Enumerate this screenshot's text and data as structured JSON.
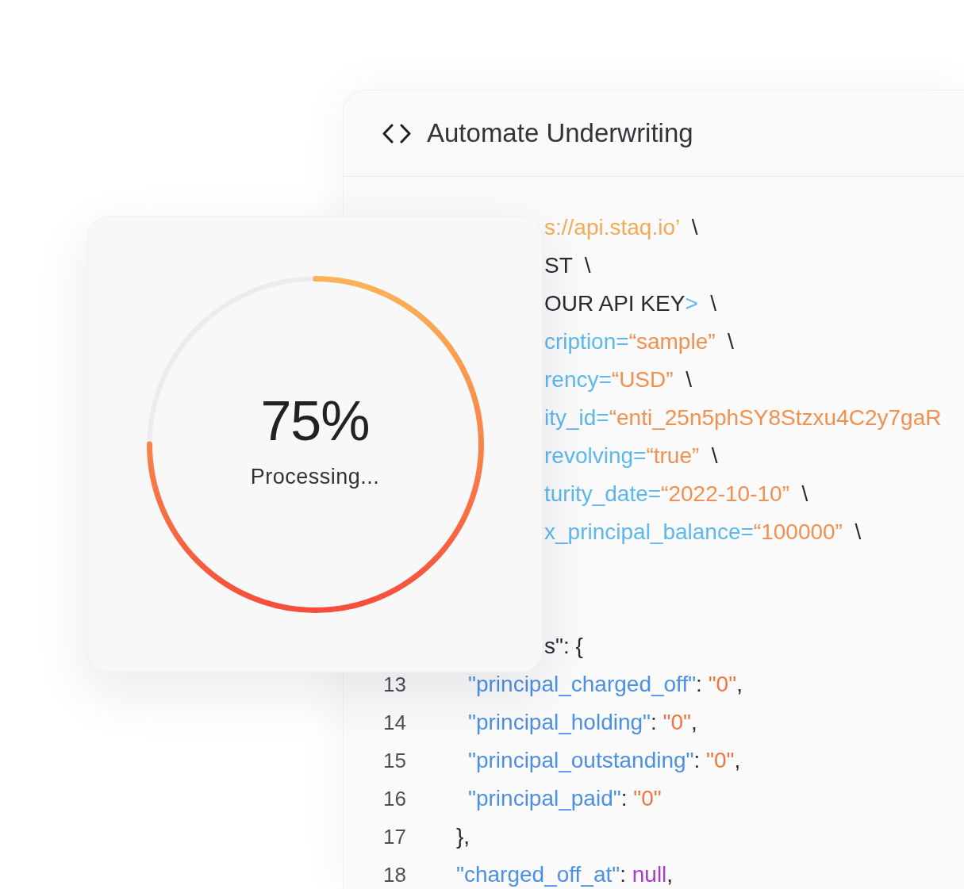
{
  "code_panel": {
    "title": "Automate Underwriting",
    "upper_lines": [
      {
        "segments": [
          {
            "kind": "url",
            "text": "s://api.staq.io’"
          },
          {
            "kind": "text",
            "text": "  \\"
          }
        ]
      },
      {
        "segments": [
          {
            "kind": "text",
            "text": "ST  \\"
          }
        ]
      },
      {
        "segments": [
          {
            "kind": "text",
            "text": "OUR API KEY"
          },
          {
            "kind": "param",
            "text": ">"
          },
          {
            "kind": "text",
            "text": "  \\"
          }
        ]
      },
      {
        "segments": [
          {
            "kind": "param",
            "text": "cription="
          },
          {
            "kind": "param_value",
            "text": "“sample”"
          },
          {
            "kind": "text",
            "text": "  \\"
          }
        ]
      },
      {
        "segments": [
          {
            "kind": "param",
            "text": "rency="
          },
          {
            "kind": "param_value",
            "text": "“USD”"
          },
          {
            "kind": "text",
            "text": "  \\"
          }
        ]
      },
      {
        "segments": [
          {
            "kind": "param",
            "text": "ity_id="
          },
          {
            "kind": "param_value",
            "text": "“enti_25n5phSY8Stzxu4C2y7gaR"
          }
        ]
      },
      {
        "segments": [
          {
            "kind": "param",
            "text": "revolving="
          },
          {
            "kind": "param_value",
            "text": "“true”"
          },
          {
            "kind": "text",
            "text": "  \\"
          }
        ]
      },
      {
        "segments": [
          {
            "kind": "param",
            "text": "turity_date="
          },
          {
            "kind": "param_value",
            "text": "“2022-10-10”"
          },
          {
            "kind": "text",
            "text": "  \\"
          }
        ]
      },
      {
        "segments": [
          {
            "kind": "param",
            "text": "x_principal_balance="
          },
          {
            "kind": "param_value",
            "text": "“100000”"
          },
          {
            "kind": "text",
            "text": "  \\"
          }
        ]
      }
    ],
    "lower_lines": [
      {
        "segments": [
          {
            "kind": "text",
            "text": "s\": {"
          }
        ],
        "children": [
          {
            "number": "13",
            "segments": [
              {
                "kind": "json_key",
                "text": "\"principal_charged_off\""
              },
              {
                "kind": "text",
                "text": ": "
              },
              {
                "kind": "json_string",
                "text": "\"0\""
              },
              {
                "kind": "text",
                "text": ","
              }
            ]
          },
          {
            "number": "14",
            "segments": [
              {
                "kind": "json_key",
                "text": "\"principal_holding\""
              },
              {
                "kind": "text",
                "text": ": "
              },
              {
                "kind": "json_string",
                "text": "\"0\""
              },
              {
                "kind": "text",
                "text": ","
              }
            ]
          },
          {
            "number": "15",
            "segments": [
              {
                "kind": "json_key",
                "text": "\"principal_outstanding\""
              },
              {
                "kind": "text",
                "text": ": "
              },
              {
                "kind": "json_string",
                "text": "\"0\""
              },
              {
                "kind": "text",
                "text": ","
              }
            ]
          },
          {
            "number": "16",
            "segments": [
              {
                "kind": "json_key",
                "text": "\"principal_paid\""
              },
              {
                "kind": "text",
                "text": ": "
              },
              {
                "kind": "json_string",
                "text": "\"0\""
              }
            ]
          }
        ]
      },
      {
        "number": "17",
        "segments": [
          {
            "kind": "text",
            "text": "},"
          }
        ]
      },
      {
        "number": "18",
        "segments": [
          {
            "kind": "json_key",
            "text": "\"charged_off_at\""
          },
          {
            "kind": "text",
            "text": ": "
          },
          {
            "kind": "json_null",
            "text": "null"
          },
          {
            "kind": "text",
            "text": ","
          }
        ]
      }
    ]
  },
  "progress_card": {
    "level": 0.75,
    "percent": "75%",
    "status": "Processing..."
  }
}
